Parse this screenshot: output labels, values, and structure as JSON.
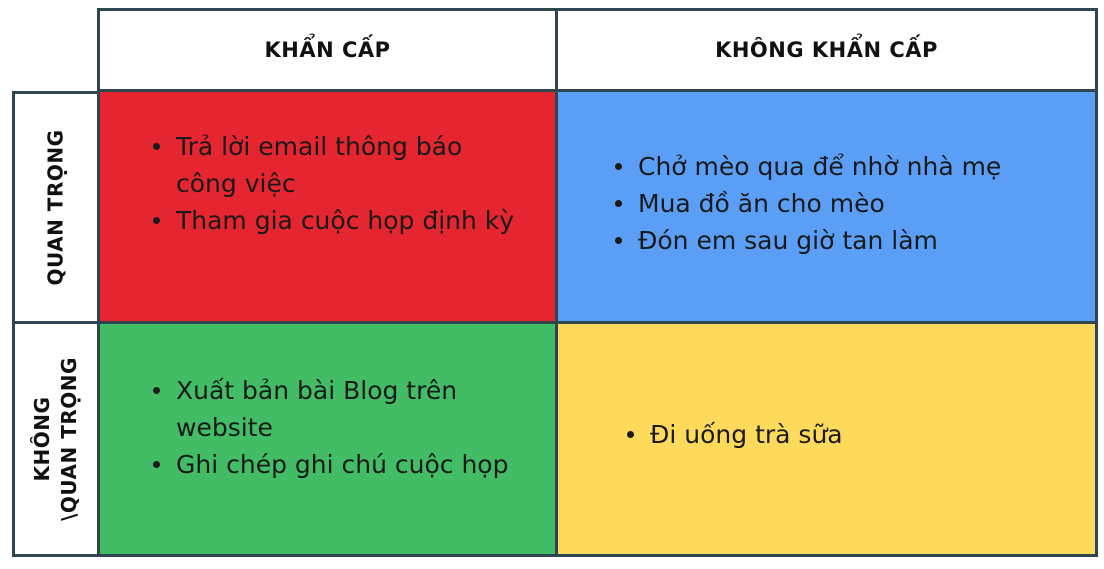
{
  "columns": {
    "urgent": "KHẨN CẤP",
    "not_urgent": "KHÔNG KHẨN CẤP"
  },
  "rows": {
    "important": "QUAN TRỌNG",
    "not_important_line1": "KHÔNG",
    "not_important_line2": "\\QUAN TRỌNG"
  },
  "quadrants": {
    "urgent_important": {
      "color": "#e52530",
      "items": [
        "Trả lời email thông báo công việc",
        "Tham gia cuộc họp định kỳ"
      ]
    },
    "not_urgent_important": {
      "color": "#5b9ef5",
      "items": [
        "Chở mèo qua để nhờ nhà mẹ",
        "Mua đồ ăn cho mèo",
        "Đón em sau giờ tan làm"
      ]
    },
    "urgent_not_important": {
      "color": "#42bd66",
      "items": [
        "Xuất bản bài Blog trên website",
        "Ghi chép ghi chú cuộc họp"
      ]
    },
    "not_urgent_not_important": {
      "color": "#fdda5c",
      "items": [
        "Đi uống trà sữa"
      ]
    }
  }
}
